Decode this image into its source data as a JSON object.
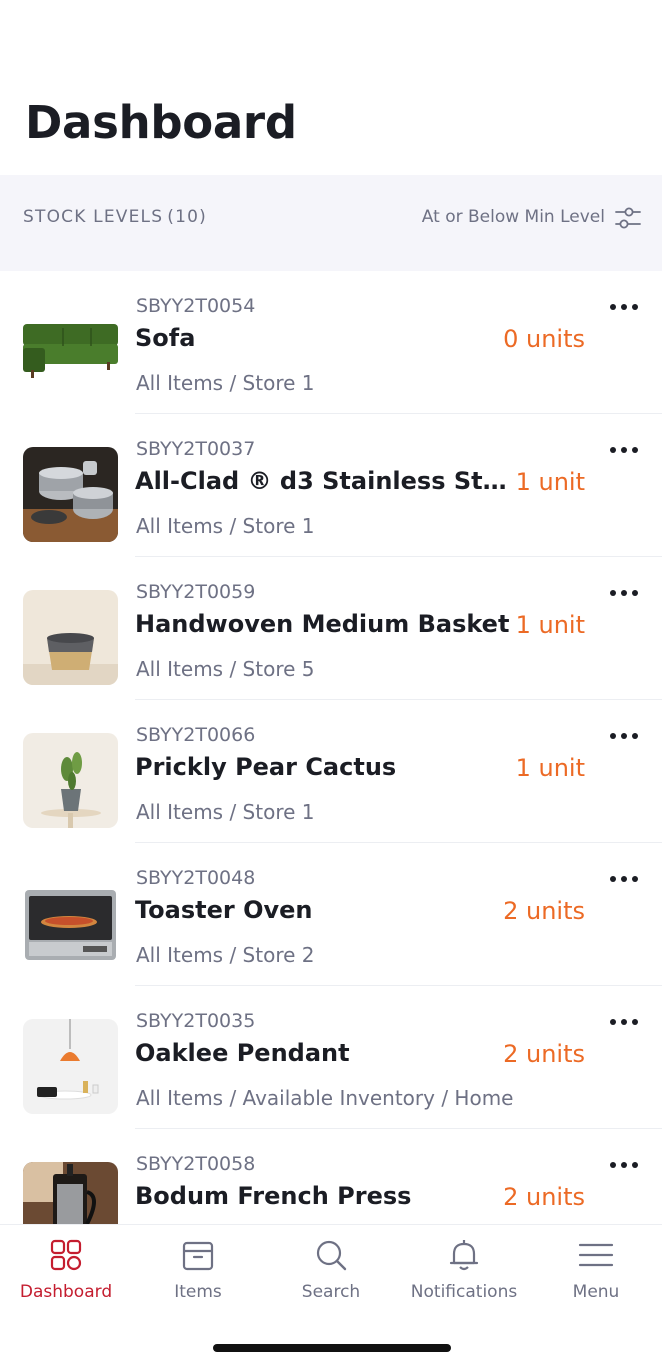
{
  "header": {
    "title": "Dashboard"
  },
  "filter": {
    "label": "STOCK LEVELS",
    "count": "(10)",
    "option": "At or Below Min Level",
    "icon": "sliders-icon"
  },
  "items": [
    {
      "sku": "SBYY2T0054",
      "name": "Sofa",
      "qty": "0 units",
      "path": "All Items / Store 1"
    },
    {
      "sku": "SBYY2T0037",
      "name": "All-Clad ® d3 Stainless Steel...",
      "qty": "1 unit",
      "path": "All Items / Store 1"
    },
    {
      "sku": "SBYY2T0059",
      "name": "Handwoven Medium Basket",
      "qty": "1 unit",
      "path": "All Items / Store 5"
    },
    {
      "sku": "SBYY2T0066",
      "name": "Prickly Pear Cactus",
      "qty": "1 unit",
      "path": "All Items / Store 1"
    },
    {
      "sku": "SBYY2T0048",
      "name": "Toaster Oven",
      "qty": "2 units",
      "path": "All Items / Store 2"
    },
    {
      "sku": "SBYY2T0035",
      "name": "Oaklee Pendant",
      "qty": "2 units",
      "path": "All Items / Available Inventory / Home"
    },
    {
      "sku": "SBYY2T0058",
      "name": "Bodum French Press",
      "qty": "2 units",
      "path": ""
    }
  ],
  "tabs": [
    {
      "label": "Dashboard",
      "icon": "dashboard-grid-icon",
      "active": true
    },
    {
      "label": "Items",
      "icon": "box-icon",
      "active": false
    },
    {
      "label": "Search",
      "icon": "search-icon",
      "active": false
    },
    {
      "label": "Notifications",
      "icon": "bell-icon",
      "active": false
    },
    {
      "label": "Menu",
      "icon": "hamburger-menu-icon",
      "active": false
    }
  ],
  "colors": {
    "accent": "#c41d2f",
    "quantity": "#ec6a25",
    "muted": "#6e7184",
    "filter_bg": "#f5f5fa"
  }
}
